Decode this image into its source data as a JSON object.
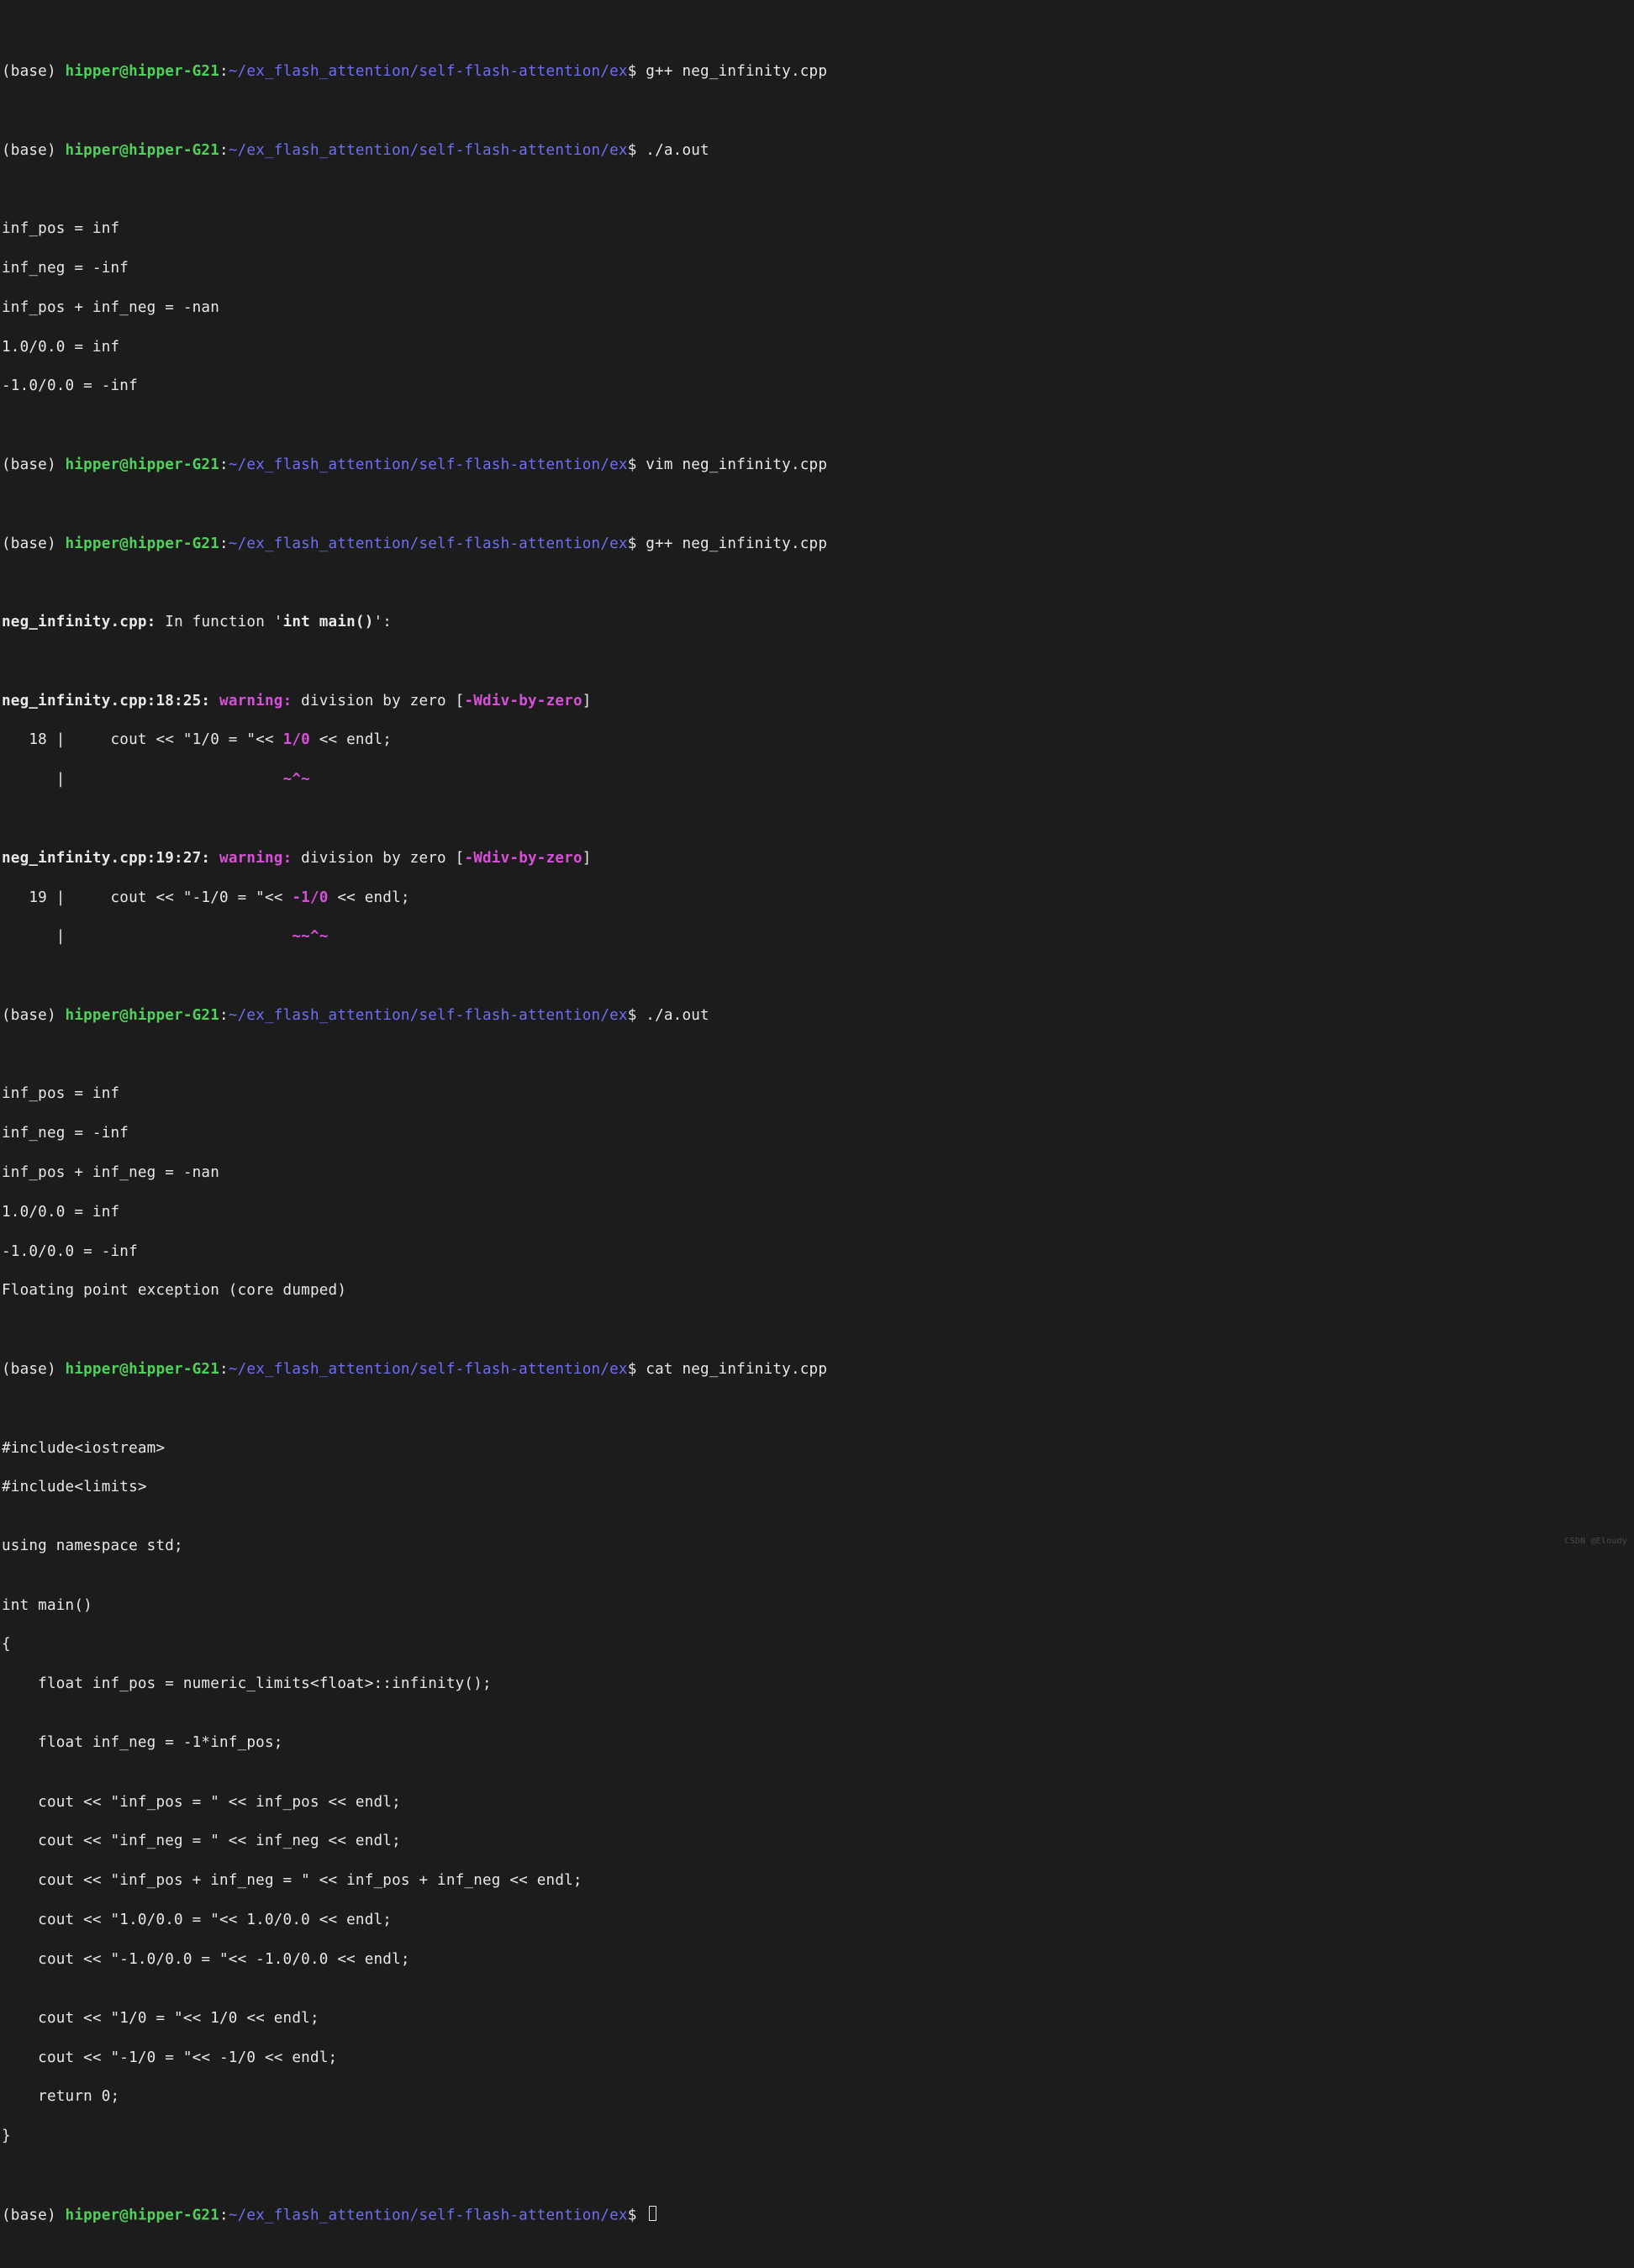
{
  "prompt": {
    "env": "(base) ",
    "user": "hipper@hipper-G21",
    "colon": ":",
    "path": "~/ex_flash_attention/self-flash-attention/ex",
    "dollar": "$ "
  },
  "lines": {
    "l01_cmd": "g++ neg_infinity.cpp",
    "l02_cmd": "./a.out",
    "l03": "inf_pos = inf",
    "l04": "inf_neg = -inf",
    "l05": "inf_pos + inf_neg = -nan",
    "l06": "1.0/0.0 = inf",
    "l07": "-1.0/0.0 = -inf",
    "l08_cmd": "vim neg_infinity.cpp",
    "l09_cmd": "g++ neg_infinity.cpp",
    "l10_file": "neg_infinity.cpp:",
    "l10_infn1": " In function '",
    "l10_fn": "int main()",
    "l10_infn2": "':",
    "l11_loc": "neg_infinity.cpp:18:25: ",
    "l11_warn": "warning: ",
    "l11_msg1": "division by zero [",
    "l11_flag": "-Wdiv-by-zero",
    "l11_msg2": "]",
    "l12_pre": "   18 |     cout << \"1/0 = \"<< ",
    "l12_hi": "1/0",
    "l12_post": " << endl;",
    "l13_pipe": "      |                        ",
    "l13_marks": "~^~",
    "l14_loc": "neg_infinity.cpp:19:27: ",
    "l14_warn": "warning: ",
    "l14_msg1": "division by zero [",
    "l14_flag": "-Wdiv-by-zero",
    "l14_msg2": "]",
    "l15_pre": "   19 |     cout << \"-1/0 = \"<< ",
    "l15_hi": "-1/0",
    "l15_post": " << endl;",
    "l16_pipe": "      |                         ",
    "l16_marks": "~~^~",
    "l17_cmd": "./a.out",
    "l18": "inf_pos = inf",
    "l19": "inf_neg = -inf",
    "l20": "inf_pos + inf_neg = -nan",
    "l21": "1.0/0.0 = inf",
    "l22": "-1.0/0.0 = -inf",
    "l23": "Floating point exception (core dumped)",
    "l24_cmd": "cat neg_infinity.cpp",
    "src01": "#include<iostream>",
    "src02": "#include<limits>",
    "src03": "",
    "src04": "using namespace std;",
    "src05": "",
    "src06": "int main()",
    "src07": "{",
    "src08": "    float inf_pos = numeric_limits<float>::infinity();",
    "src09": "",
    "src10": "    float inf_neg = -1*inf_pos;",
    "src11": "",
    "src12": "    cout << \"inf_pos = \" << inf_pos << endl;",
    "src13": "    cout << \"inf_neg = \" << inf_neg << endl;",
    "src14": "    cout << \"inf_pos + inf_neg = \" << inf_pos + inf_neg << endl;",
    "src15": "    cout << \"1.0/0.0 = \"<< 1.0/0.0 << endl;",
    "src16": "    cout << \"-1.0/0.0 = \"<< -1.0/0.0 << endl;",
    "src17": "",
    "src18": "    cout << \"1/0 = \"<< 1/0 << endl;",
    "src19": "    cout << \"-1/0 = \"<< -1/0 << endl;",
    "src20": "    return 0;",
    "src21": "}"
  },
  "watermark": "CSDN @Eloudy"
}
